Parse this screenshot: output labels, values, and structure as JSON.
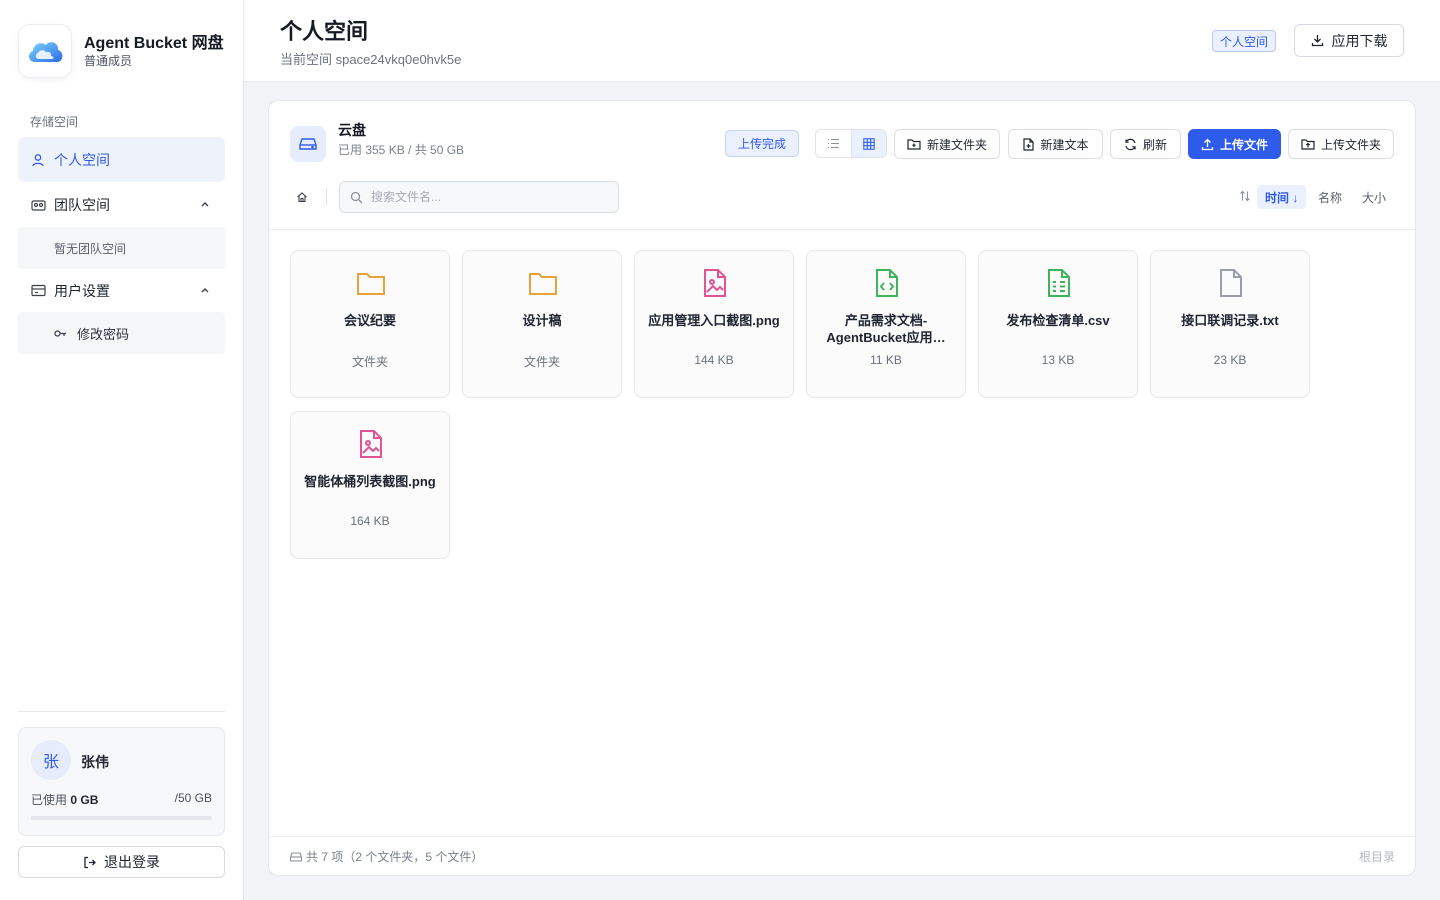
{
  "brand": {
    "title": "Agent Bucket 网盘",
    "subtitle": "普通成员",
    "logo_icon": "cloud-logo-icon"
  },
  "sidebar": {
    "section_label": "存储空间",
    "items": [
      {
        "label": "个人空间",
        "icon": "user-icon",
        "active": true
      },
      {
        "label": "团队空间",
        "icon": "team-icon",
        "expanded": true,
        "empty_text": "暂无团队空间"
      },
      {
        "label": "用户设置",
        "icon": "settings-card-icon",
        "expanded": true,
        "sub_items": [
          {
            "label": "修改密码",
            "icon": "key-icon"
          }
        ]
      }
    ]
  },
  "user": {
    "avatar_text": "张",
    "name": "张伟",
    "used_label": "已使用",
    "used_value": "0 GB",
    "total": "/50 GB",
    "usage_fraction": 0
  },
  "logout_label": "退出登录",
  "header": {
    "title": "个人空间",
    "subtitle": "当前空间 space24vkq0e0hvk5e",
    "badge": "个人空间",
    "download_label": "应用下载"
  },
  "disk": {
    "title": "云盘",
    "usage": "已用 355 KB / 共 50 GB"
  },
  "toolbar": {
    "upload_status": "上传完成",
    "new_folder": "新建文件夹",
    "new_text": "新建文本",
    "refresh": "刷新",
    "upload_file": "上传文件",
    "upload_folder": "上传文件夹",
    "view_mode": "grid"
  },
  "search": {
    "placeholder": "搜索文件名...",
    "value": ""
  },
  "sort": {
    "time": "时间 ↓",
    "name": "名称",
    "size": "大小",
    "active": "time"
  },
  "files": [
    {
      "name": "会议纪要",
      "meta": "文件夹",
      "type": "folder"
    },
    {
      "name": "设计稿",
      "meta": "文件夹",
      "type": "folder"
    },
    {
      "name": "应用管理入口截图.png",
      "meta": "144 KB",
      "type": "image"
    },
    {
      "name": "产品需求文档-AgentBucket应用…",
      "meta": "11 KB",
      "type": "code"
    },
    {
      "name": "发布检查清单.csv",
      "meta": "13 KB",
      "type": "sheet"
    },
    {
      "name": "接口联调记录.txt",
      "meta": "23 KB",
      "type": "text"
    },
    {
      "name": "智能体桶列表截图.png",
      "meta": "164 KB",
      "type": "image"
    }
  ],
  "footer": {
    "count": "共 7 项（2 个文件夹，5 个文件）",
    "root": "根目录"
  },
  "colors": {
    "accent": "#2f5bea",
    "folder": "#e8a23a",
    "image": "#e05493",
    "code": "#3fb45a",
    "sheet": "#3fb45a",
    "text": "#9aa0ab"
  }
}
